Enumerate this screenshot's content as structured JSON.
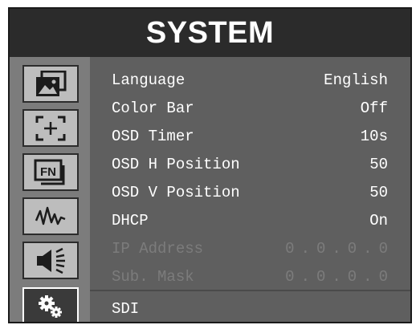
{
  "title": "SYSTEM",
  "sidebar": {
    "items": [
      {
        "icon": "picture-icon"
      },
      {
        "icon": "marker-icon"
      },
      {
        "icon": "fn-icon"
      },
      {
        "icon": "waveform-icon"
      },
      {
        "icon": "speaker-icon"
      },
      {
        "icon": "gears-icon",
        "active": true
      }
    ]
  },
  "settings": [
    {
      "label": "Language",
      "value": "English"
    },
    {
      "label": "Color Bar",
      "value": "Off"
    },
    {
      "label": "OSD Timer",
      "value": "10s"
    },
    {
      "label": "OSD H Position",
      "value": "50"
    },
    {
      "label": "OSD V Position",
      "value": "50"
    },
    {
      "label": "DHCP",
      "value": "On"
    },
    {
      "label": "IP Address",
      "value": "0.0.0.0",
      "disabled": true
    },
    {
      "label": "Sub. Mask",
      "value": "0.0.0.0",
      "disabled": true
    }
  ],
  "page_item": {
    "label": "SDI"
  }
}
